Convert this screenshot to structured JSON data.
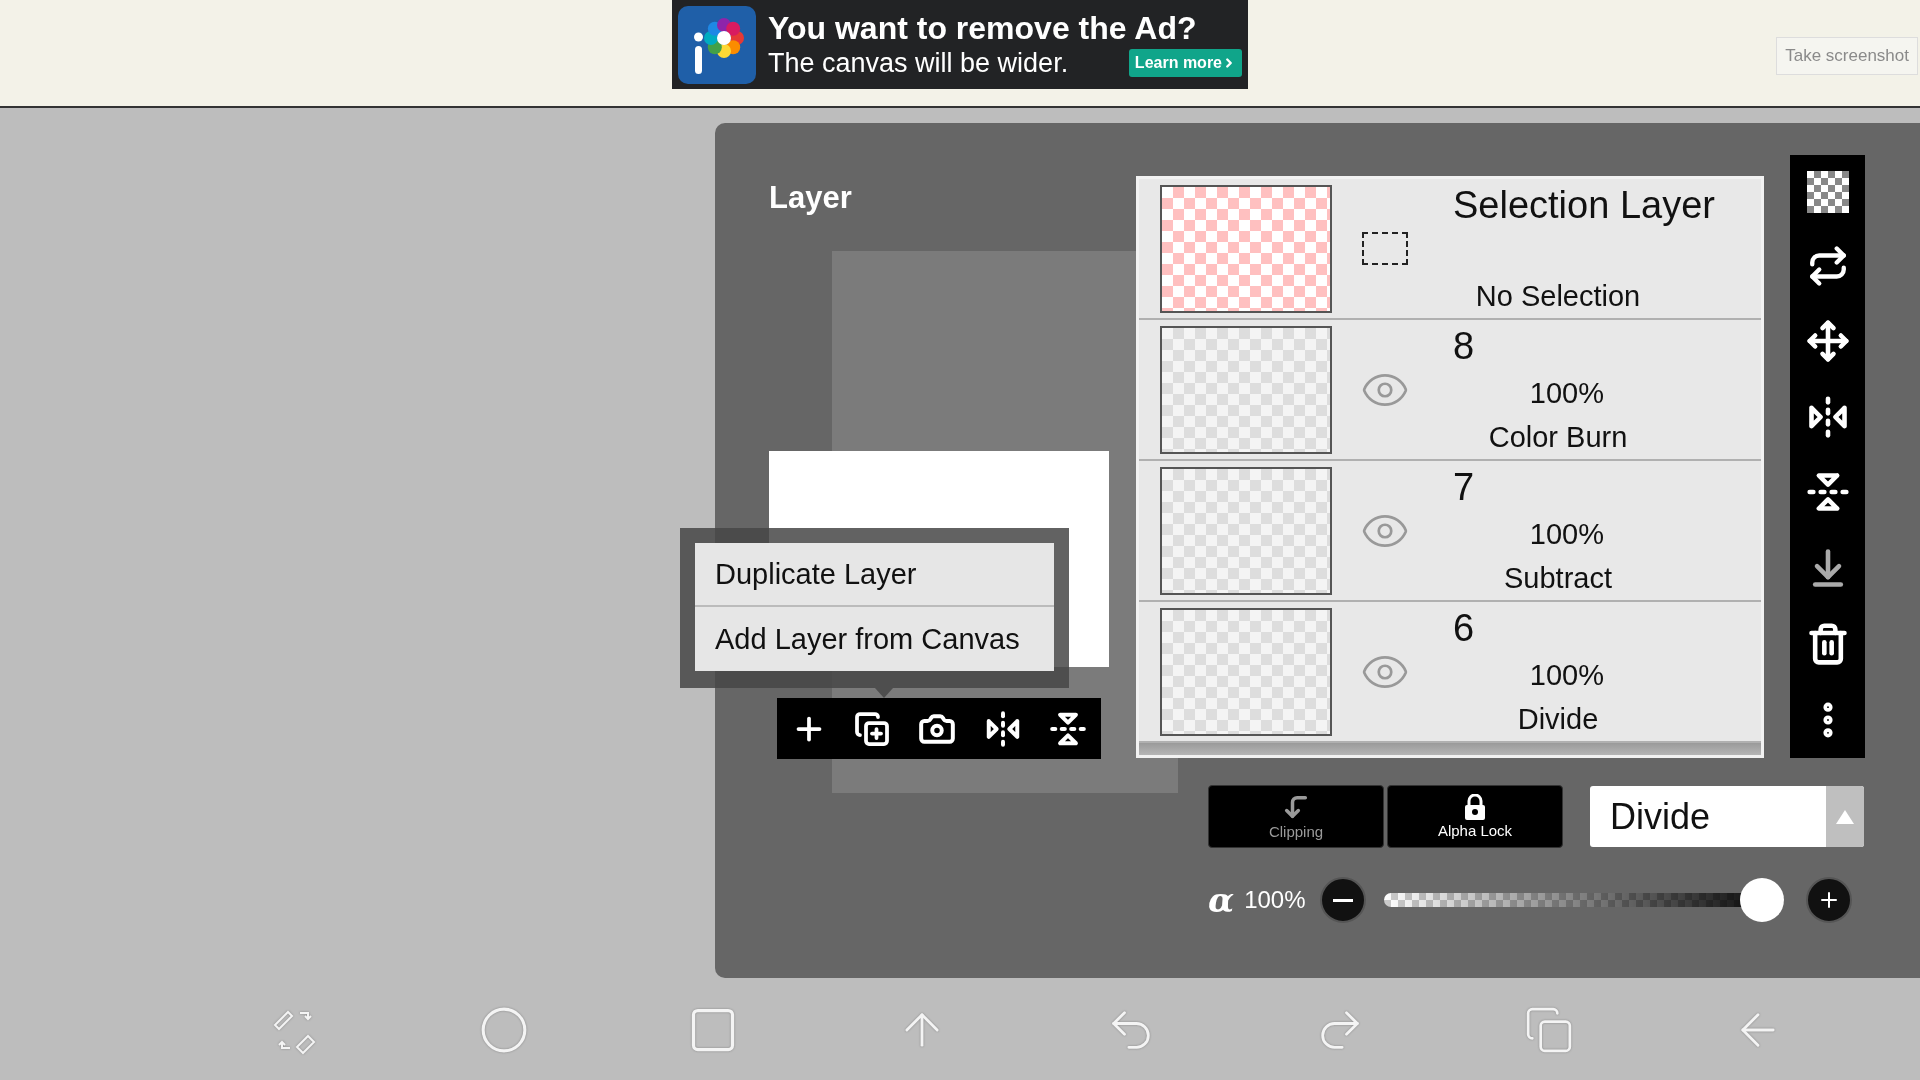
{
  "top_bar": {
    "ad": {
      "headline": "You want to remove the Ad?",
      "subline": "The canvas will be wider.",
      "button": "Learn more"
    },
    "screenshot_button": "Take screenshot"
  },
  "panel": {
    "title": "Layer"
  },
  "context_menu": {
    "items": [
      {
        "label": "Duplicate Layer"
      },
      {
        "label": "Add Layer from Canvas"
      }
    ]
  },
  "layers": [
    {
      "kind": "selection",
      "name": "Selection Layer",
      "status": "No Selection"
    },
    {
      "kind": "layer",
      "name": "8",
      "opacity": "100%",
      "blend": "Color Burn",
      "visible": true
    },
    {
      "kind": "layer",
      "name": "7",
      "opacity": "100%",
      "blend": "Subtract",
      "visible": true
    },
    {
      "kind": "layer",
      "name": "6",
      "opacity": "100%",
      "blend": "Divide",
      "visible": true
    }
  ],
  "layer_options": [
    {
      "kind": "clipping",
      "label": "Clipping",
      "disabled": true
    },
    {
      "kind": "alpha_lock",
      "label": "Alpha Lock",
      "disabled": false
    }
  ],
  "blend_select": {
    "value": "Divide"
  },
  "opacity": {
    "symbol": "α",
    "reading": "100%",
    "level": 1
  }
}
